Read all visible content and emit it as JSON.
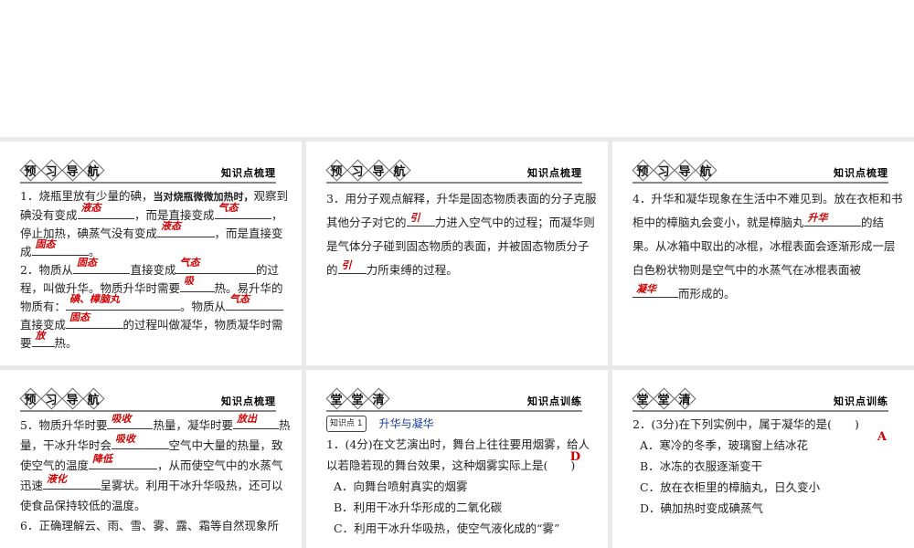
{
  "slides": [
    {
      "badges": [
        "预",
        "习",
        "导",
        "航"
      ],
      "label": "知识点梳理",
      "lh": 20,
      "paras": [
        [
          {
            "t": "1．烧瓶里放有少量的碘，"
          },
          {
            "t": "当对烧瓶微微加热时，",
            "bold": true
          },
          {
            "t": "观察到碘没有变成"
          },
          {
            "a": "液态",
            "w": 5
          },
          {
            "t": "，而是直接变成"
          },
          {
            "a": "气态",
            "w": 5
          },
          {
            "t": "，停止加热，碘蒸气没有变成"
          },
          {
            "a": "液态",
            "w": 5
          },
          {
            "t": "，而是直接变成"
          },
          {
            "a": "固态",
            "w": 5
          },
          {
            "t": "。"
          }
        ],
        [
          {
            "t": "2．物质从"
          },
          {
            "a": "固态",
            "w": 5
          },
          {
            "t": "直接变成"
          },
          {
            "a": "气态",
            "w": 7
          },
          {
            "t": "的过程，叫做升华。物质升华时需要"
          },
          {
            "a": "吸",
            "w": 3
          },
          {
            "t": "热。易升华的物质有："
          },
          {
            "a": "碘、樟脑丸",
            "w": 10
          },
          {
            "t": "。物质从"
          },
          {
            "a": "气态",
            "w": 5
          },
          {
            "t": "直接变成"
          },
          {
            "a": "固态",
            "w": 5
          },
          {
            "t": "的过程叫做凝华，物质凝华时需要"
          },
          {
            "a": "放",
            "w": 2
          },
          {
            "t": "热。"
          }
        ]
      ]
    },
    {
      "badges": [
        "预",
        "习",
        "导",
        "航"
      ],
      "label": "知识点梳理",
      "lh": 26,
      "paras": [
        [
          {
            "t": "3．用分子观点解释，升华是固态物质表面的分子克服其他分子对它的"
          },
          {
            "a": "引",
            "w": 2.5
          },
          {
            "t": "力进入空气中的过程；而凝华则是气体分子碰到固态物质的表面，并被固态物质分子的"
          },
          {
            "a": "引",
            "w": 2.5
          },
          {
            "t": "力所束缚的过程。"
          }
        ]
      ]
    },
    {
      "badges": [
        "预",
        "习",
        "导",
        "航"
      ],
      "label": "知识点梳理",
      "lh": 26,
      "paras": [
        [
          {
            "t": "4．升华和凝华现象在生活中不难见到。放在衣柜和书柜中的樟脑丸会变小，就是樟脑丸"
          },
          {
            "a": "升华",
            "w": 5
          },
          {
            "t": "的结果。从冰箱中取出的冰棍，冰棍表面会逐渐形成一层白色粉状物则是空气中的水蒸气在冰棍表面被"
          },
          {
            "a": "凝华",
            "w": 4
          },
          {
            "t": "而形成的。"
          }
        ]
      ]
    },
    {
      "badges": [
        "预",
        "习",
        "导",
        "航"
      ],
      "label": "知识点梳理",
      "lh": 22,
      "paras": [
        [
          {
            "t": "5．物质升华时要"
          },
          {
            "a": "吸收",
            "w": 4
          },
          {
            "t": "热量，凝华时要"
          },
          {
            "a": "放出",
            "w": 4
          },
          {
            "t": "热量，干冰升华时会"
          },
          {
            "a": "吸收",
            "w": 5
          },
          {
            "t": "空气中大量的热量，致使空气的温度"
          },
          {
            "a": "降低",
            "w": 6
          },
          {
            "t": "，从而使空气中的水蒸气迅速"
          },
          {
            "a": "液化",
            "w": 5
          },
          {
            "t": "呈雾状。利用干冰升华吸热，还可以使食品保持较低的温度。"
          }
        ],
        [
          {
            "t": "6．正确理解云、雨、雪、雾、露、霜等自然现象所"
          }
        ]
      ]
    },
    {
      "badges": [
        "堂",
        "堂",
        "清"
      ],
      "label": "知识点训练",
      "lh": 23,
      "kp": {
        "badge": "知识点",
        "num": "1",
        "title": "升华与凝华"
      },
      "q": "1．(4分)在文艺演出时，舞台上往往要用烟雾，给人以若隐若现的舞台效果，这种烟雾实际上是(　　)",
      "answer": "D",
      "options": [
        "A．向舞台喷射真实的烟雾",
        "B．利用干冰升华形成的二氧化碳",
        "C．利用干冰升华吸热，使空气液化成的“雾”"
      ]
    },
    {
      "badges": [
        "堂",
        "堂",
        "清"
      ],
      "label": "知识点训练",
      "lh": 23,
      "q": "2．(3分)在下列实例中，属于凝华的是(　　)",
      "answer": "A",
      "options": [
        "A．寒冷的冬季，玻璃窗上结冰花",
        "B．冰冻的衣服逐渐变干",
        "C．放在衣柜里的樟脑丸，日久变小",
        "D．碘加热时变成碘蒸气"
      ]
    }
  ]
}
